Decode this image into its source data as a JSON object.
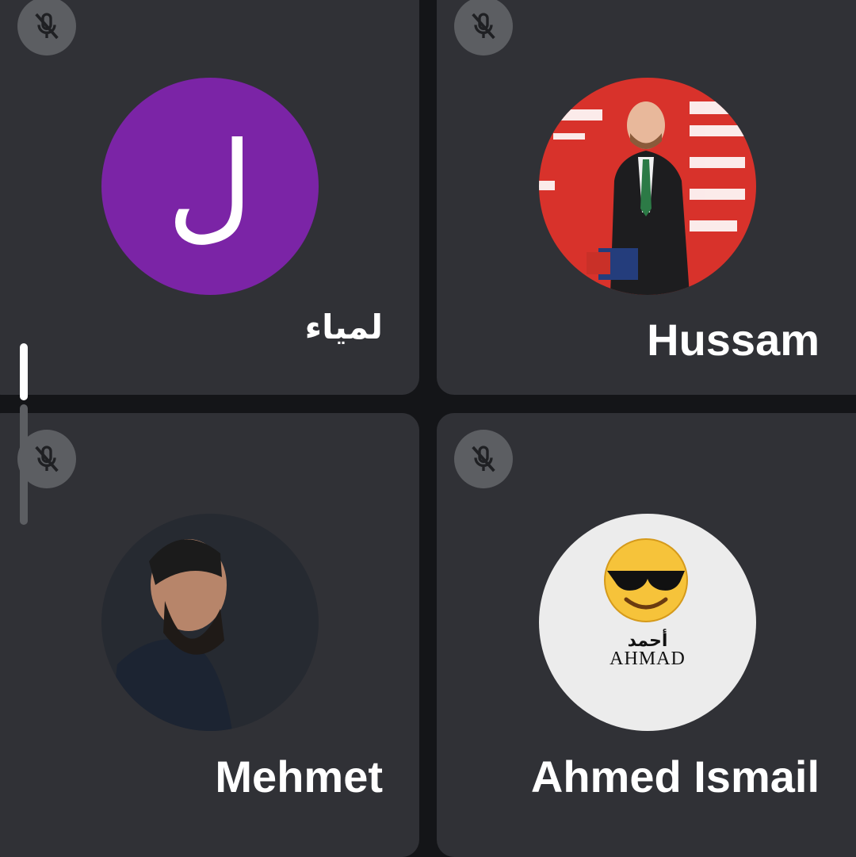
{
  "participants": [
    {
      "name": "لمياء",
      "initial": "ل",
      "avatar_type": "initial",
      "avatar_color": "#7b24a6",
      "muted": true,
      "mic_icon": "mic-off-icon"
    },
    {
      "name": "Hussam",
      "avatar_type": "photo",
      "muted": true,
      "mic_icon": "mic-off-icon"
    },
    {
      "name": "Mehmet",
      "avatar_type": "photo",
      "muted": true,
      "mic_icon": "mic-off-icon"
    },
    {
      "name": "Ahmed Ismail",
      "avatar_type": "logo",
      "avatar_text_ar": "أحمد",
      "avatar_text_en": "AHMAD",
      "muted": true,
      "mic_icon": "mic-off-icon"
    }
  ],
  "colors": {
    "background": "#141518",
    "tile": "#303136",
    "mute_badge": "#5c5e62",
    "name_text": "#ffffff"
  }
}
